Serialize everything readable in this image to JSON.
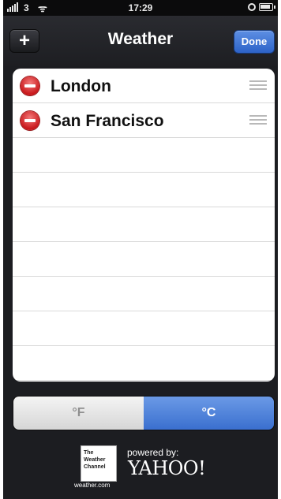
{
  "status_bar": {
    "carrier": "3",
    "time": "17:29",
    "icons": [
      "signal-icon",
      "wifi-icon",
      "rotation-lock-icon",
      "battery-icon"
    ]
  },
  "nav": {
    "add_label": "+",
    "title": "Weather",
    "done_label": "Done"
  },
  "cities": [
    {
      "name": "London"
    },
    {
      "name": "San Francisco"
    }
  ],
  "units": {
    "fahrenheit": "°F",
    "celsius": "°C",
    "selected": "celsius"
  },
  "footer": {
    "twc_logo_lines": [
      "The",
      "Weather",
      "Channel"
    ],
    "twc_site": "weather.com",
    "powered_by": "powered by:",
    "yahoo": "YAHOO!"
  },
  "colors": {
    "accent_blue": "#3a6fcf",
    "delete_red": "#c9191c",
    "background_dark": "#1c1d21"
  }
}
